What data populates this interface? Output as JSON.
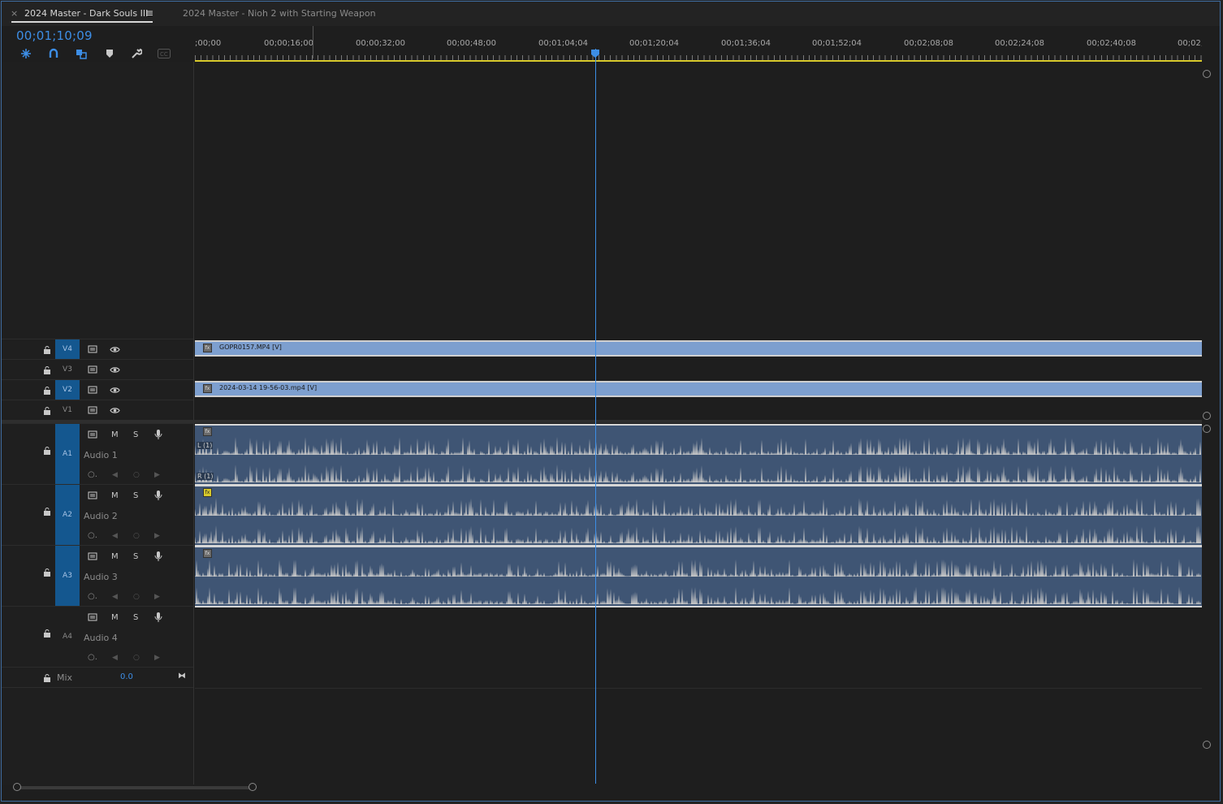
{
  "tabs": [
    {
      "label": "2024 Master - Dark Souls III",
      "active": true
    },
    {
      "label": "2024 Master - Nioh 2 with Starting Weapon",
      "active": false
    }
  ],
  "close_glyph": "×",
  "menu_glyph": "≡",
  "timecode": "00;01;10;09",
  "tools": [
    {
      "name": "nest-sequence-icon"
    },
    {
      "name": "snap-icon"
    },
    {
      "name": "linked-selection-icon"
    },
    {
      "name": "add-marker-icon"
    },
    {
      "name": "wrench-icon"
    },
    {
      "name": "captions-icon"
    }
  ],
  "ruler": {
    "labels": [
      ";00;00",
      "00;00;16;00",
      "00;00;32;00",
      "00;00;48;00",
      "00;01;04;04",
      "00;01;20;04",
      "00;01;36;04",
      "00;01;52;04",
      "00;02;08;08",
      "00;02;24;08",
      "00;02;40;08",
      "00;02;"
    ]
  },
  "video_tracks": [
    {
      "tag": "V4",
      "targeted": true
    },
    {
      "tag": "V3",
      "targeted": false
    },
    {
      "tag": "V2",
      "targeted": true
    },
    {
      "tag": "V1",
      "targeted": false
    }
  ],
  "video_clips": [
    {
      "track": "V4",
      "label": "GOPR0157.MP4 [V]"
    },
    {
      "track": "V2",
      "label": "2024-03-14 19-56-03.mp4 [V]"
    }
  ],
  "audio_tracks": [
    {
      "tag": "A1",
      "name": "Audio 1",
      "targeted": true
    },
    {
      "tag": "A2",
      "name": "Audio 2",
      "targeted": true
    },
    {
      "tag": "A3",
      "name": "Audio 3",
      "targeted": true
    },
    {
      "tag": "A4",
      "name": "Audio 4",
      "targeted": false
    }
  ],
  "audio_buttons": {
    "mute": "M",
    "solo": "S"
  },
  "channel_labels": {
    "left": "L (1)",
    "right": "R (1)"
  },
  "mix": {
    "label": "Mix",
    "value": "0.0"
  },
  "colors": {
    "accent": "#3d8ee6",
    "video_clip": "#7d9fcf",
    "audio_clip": "#3f5574",
    "work_area": "#d7c92b",
    "track_target": "#14578f"
  }
}
